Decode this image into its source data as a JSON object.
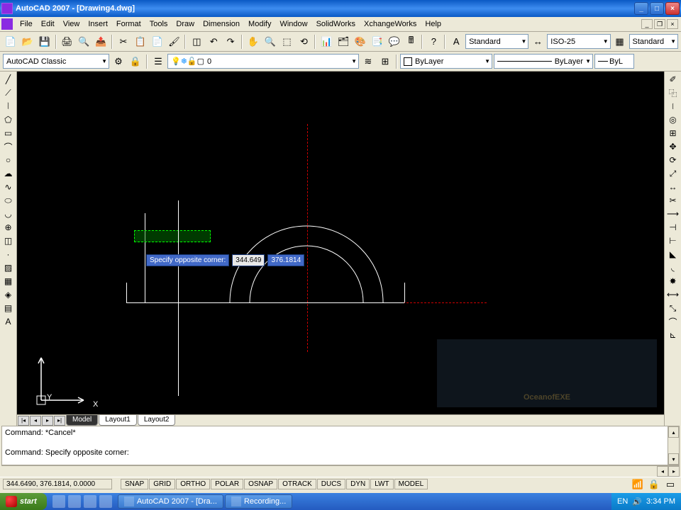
{
  "titlebar": {
    "title": "AutoCAD 2007 - [Drawing4.dwg]"
  },
  "menu": [
    "File",
    "Edit",
    "View",
    "Insert",
    "Format",
    "Tools",
    "Draw",
    "Dimension",
    "Modify",
    "Window",
    "SolidWorks",
    "XchangeWorks",
    "Help"
  ],
  "tb1": {
    "text_style": "Standard",
    "dim_style": "ISO-25",
    "table_style": "Standard"
  },
  "tb2": {
    "workspace": "AutoCAD Classic",
    "layer": "0",
    "color": "ByLayer",
    "linetype": "ByLayer",
    "lineweight": "ByL"
  },
  "tooltip": {
    "label": "Specify opposite corner:",
    "val1": "344.649",
    "val2": "376.1814"
  },
  "watermark": "OceanofEXE",
  "tabs": {
    "model": "Model",
    "l1": "Layout1",
    "l2": "Layout2"
  },
  "cmd": {
    "line1": "Command: *Cancel*",
    "line2": "",
    "line3": "Command: Specify opposite corner:"
  },
  "status": {
    "coords": "344.6490, 376.1814, 0.0000",
    "buttons": [
      "SNAP",
      "GRID",
      "ORTHO",
      "POLAR",
      "OSNAP",
      "OTRACK",
      "DUCS",
      "DYN",
      "LWT",
      "MODEL"
    ]
  },
  "taskbar": {
    "start": "start",
    "tasks": [
      {
        "label": "AutoCAD 2007 - [Dra..."
      },
      {
        "label": "Recording..."
      }
    ],
    "lang": "EN",
    "clock": "3:34 PM"
  },
  "axis": {
    "y": "Y",
    "x": "X"
  }
}
